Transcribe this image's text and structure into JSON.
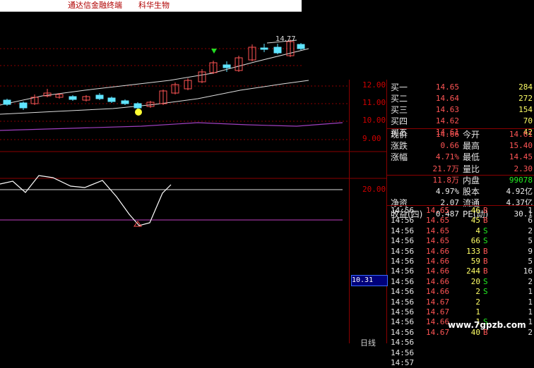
{
  "titlebar": {
    "app": "通达信金融终端",
    "stock": "科华生物"
  },
  "chart": {
    "price_label": "14.77",
    "y_ticks": [
      "12.00",
      "11.00",
      "10.00",
      "9.00"
    ],
    "ind_tick": "20.00",
    "crosshair_value": "10.31",
    "bottom_label": "日线"
  },
  "order_book": [
    {
      "label": "买一",
      "price": "14.65",
      "vol": "284"
    },
    {
      "label": "买二",
      "price": "14.64",
      "vol": "272"
    },
    {
      "label": "买三",
      "price": "14.63",
      "vol": "154"
    },
    {
      "label": "买四",
      "price": "14.62",
      "vol": "70"
    },
    {
      "label": "买五",
      "price": "14.61",
      "vol": "42"
    }
  ],
  "stats": [
    {
      "l1": "现价",
      "v1": "14.66",
      "l2": "今开",
      "v2": "14.61"
    },
    {
      "l1": "涨跌",
      "v1": "0.66",
      "l2": "最高",
      "v2": "15.40"
    },
    {
      "l1": "涨幅",
      "v1": "4.71%",
      "l2": "最低",
      "v2": "14.45"
    },
    {
      "l1": "",
      "v1": "21.7万",
      "l2": "量比",
      "v2": "2.30"
    },
    {
      "l1": "",
      "v1": "11.8万",
      "l2": "内盘",
      "v2": "99078"
    },
    {
      "l1": "",
      "v1": "4.97%",
      "l2": "股本",
      "v2": "4.92亿"
    },
    {
      "l1": "净资",
      "v1": "2.07",
      "l2": "流通",
      "v2": "4.37亿"
    },
    {
      "l1": "收益(四)",
      "v1": "0.487",
      "l2": "PE(动)",
      "v2": "30.1"
    }
  ],
  "trades": [
    {
      "time": "14:56",
      "price": "14.65",
      "vol": "46",
      "bs": "B",
      "cnt": "1"
    },
    {
      "time": "14:56",
      "price": "14.65",
      "vol": "45",
      "bs": "B",
      "cnt": "6"
    },
    {
      "time": "14:56",
      "price": "14.65",
      "vol": "4",
      "bs": "S",
      "cnt": "2"
    },
    {
      "time": "14:56",
      "price": "14.65",
      "vol": "66",
      "bs": "S",
      "cnt": "5"
    },
    {
      "time": "14:56",
      "price": "14.66",
      "vol": "133",
      "bs": "B",
      "cnt": "9"
    },
    {
      "time": "14:56",
      "price": "14.66",
      "vol": "59",
      "bs": "B",
      "cnt": "5"
    },
    {
      "time": "14:56",
      "price": "14.66",
      "vol": "244",
      "bs": "B",
      "cnt": "16"
    },
    {
      "time": "14:56",
      "price": "14.66",
      "vol": "20",
      "bs": "S",
      "cnt": "2"
    },
    {
      "time": "14:56",
      "price": "14.66",
      "vol": "2",
      "bs": "S",
      "cnt": "1"
    },
    {
      "time": "14:56",
      "price": "14.67",
      "vol": "2",
      "bs": "",
      "cnt": "1"
    },
    {
      "time": "14:56",
      "price": "14.67",
      "vol": "1",
      "bs": "",
      "cnt": "1"
    },
    {
      "time": "14:56",
      "price": "14.66",
      "vol": "1",
      "bs": "S",
      "cnt": "1"
    },
    {
      "time": "14:56",
      "price": "14.67",
      "vol": "40",
      "bs": "B",
      "cnt": "2"
    },
    {
      "time": "14:56",
      "price": "",
      "vol": "",
      "bs": "",
      "cnt": ""
    },
    {
      "time": "14:56",
      "price": "",
      "vol": "",
      "bs": "",
      "cnt": ""
    },
    {
      "time": "14:57",
      "price": "",
      "vol": "",
      "bs": "",
      "cnt": ""
    }
  ],
  "watermark": "www.7gpzb.com",
  "colors": {
    "up": "#ff5555",
    "down": "#5fe4ff",
    "grid": "#8b0000"
  }
}
